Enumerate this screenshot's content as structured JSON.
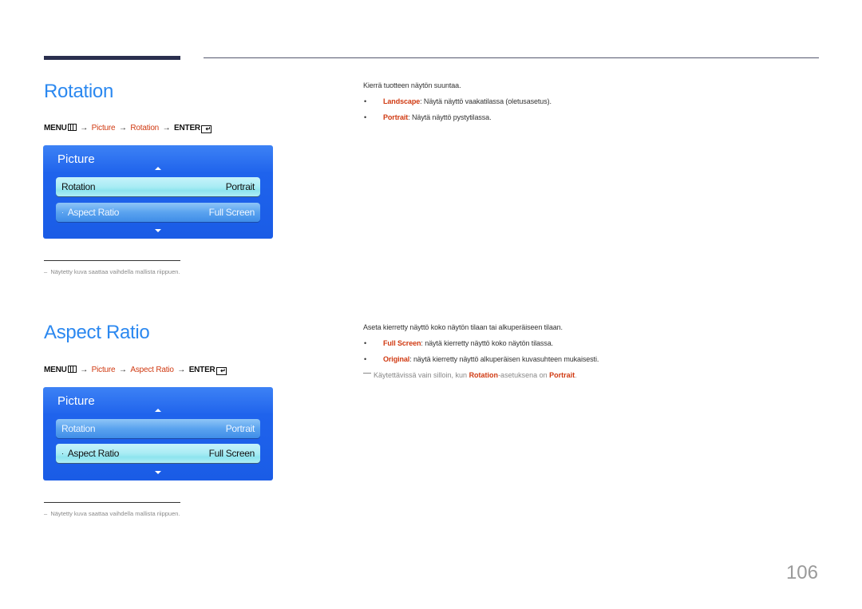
{
  "page_number": "106",
  "rotation": {
    "title": "Rotation",
    "menu_path": {
      "menu": "MENU",
      "arrow": "→",
      "step1": "Picture",
      "step2": "Rotation",
      "enter": "ENTER"
    },
    "panel": {
      "title": "Picture",
      "rows": [
        {
          "label": "Rotation",
          "value": "Portrait",
          "selected": true
        },
        {
          "label": "Aspect Ratio",
          "value": "Full Screen",
          "selected": false
        }
      ]
    },
    "footnote": "Näytetty kuva saattaa vaihdella mallista riippuen.",
    "description": "Kierrä tuotteen näytön suuntaa.",
    "bullets": [
      {
        "keyword": "Landscape",
        "text": ": Näytä näyttö vaakatilassa (oletusasetus)."
      },
      {
        "keyword": "Portrait",
        "text": ": Näytä näyttö pystytilassa."
      }
    ]
  },
  "aspect_ratio": {
    "title": "Aspect Ratio",
    "menu_path": {
      "menu": "MENU",
      "arrow": "→",
      "step1": "Picture",
      "step2": "Aspect Ratio",
      "enter": "ENTER"
    },
    "panel": {
      "title": "Picture",
      "rows": [
        {
          "label": "Rotation",
          "value": "Portrait",
          "selected": false
        },
        {
          "label": "Aspect Ratio",
          "value": "Full Screen",
          "selected": true
        }
      ]
    },
    "footnote": "Näytetty kuva saattaa vaihdella mallista riippuen.",
    "description": "Aseta kierretty näyttö koko näytön tilaan tai alkuperäiseen tilaan.",
    "bullets": [
      {
        "keyword": "Full Screen",
        "text": ": näytä kierretty näyttö koko näytön tilassa."
      },
      {
        "keyword": "Original",
        "text": ": näytä kierretty näyttö alkuperäisen kuvasuhteen mukaisesti."
      }
    ],
    "note": {
      "prefix": "Käytettävissä vain silloin, kun ",
      "kw1": "Rotation",
      "middle": "-asetuksena on ",
      "kw2": "Portrait",
      "suffix": "."
    }
  },
  "colors": {
    "heading": "#2b88f0",
    "keyword": "#d03a12",
    "panel": "#1f63ec"
  }
}
